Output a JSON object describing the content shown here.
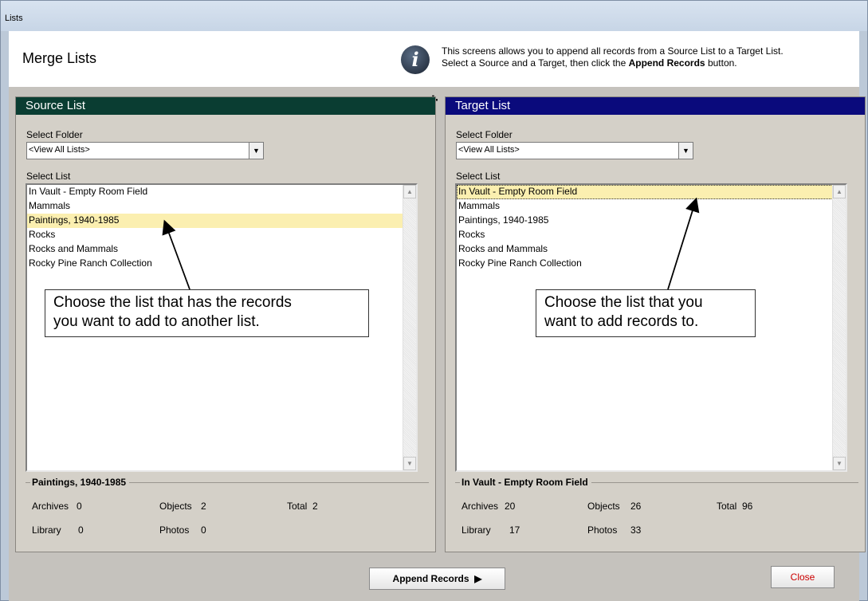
{
  "window": {
    "title": "Lists"
  },
  "header": {
    "title": "Merge Lists",
    "info_icon": "info-icon",
    "desc_line1": "This screens allows you to append all records from a Source List to a Target List.",
    "desc_line2_prefix": "Select a Source and a Target, then click the ",
    "desc_line2_bold": "Append Records",
    "desc_line2_suffix": " button."
  },
  "plus_symbol": "+",
  "source": {
    "header": "Source List",
    "folder_label": "Select Folder",
    "folder_value": "<View All Lists>",
    "list_label": "Select List",
    "items": [
      "In Vault - Empty Room Field",
      "Mammals",
      "Paintings, 1940-1985",
      "Rocks",
      "Rocks and Mammals",
      "Rocky Pine Ranch Collection"
    ],
    "selected_item": "Paintings, 1940-1985",
    "callout_line1": "Choose the list that has the records",
    "callout_line2": "you want to add to another list.",
    "summary_title": "Paintings, 1940-1985",
    "stats": {
      "archives_label": "Archives",
      "archives": "0",
      "objects_label": "Objects",
      "objects": "2",
      "total_label": "Total",
      "total": "2",
      "library_label": "Library",
      "library": "0",
      "photos_label": "Photos",
      "photos": "0"
    }
  },
  "target": {
    "header": "Target List",
    "folder_label": "Select Folder",
    "folder_value": "<View All Lists>",
    "list_label": "Select List",
    "items": [
      "In Vault - Empty Room Field",
      "Mammals",
      "Paintings, 1940-1985",
      "Rocks",
      "Rocks and Mammals",
      "Rocky Pine Ranch Collection"
    ],
    "selected_item": "In Vault - Empty Room Field",
    "callout_line1": "Choose the list that you",
    "callout_line2": "want to add records to.",
    "summary_title": "In Vault - Empty Room Field",
    "stats": {
      "archives_label": "Archives",
      "archives": "20",
      "objects_label": "Objects",
      "objects": "26",
      "total_label": "Total",
      "total": "96",
      "library_label": "Library",
      "library": "17",
      "photos_label": "Photos",
      "photos": "33"
    }
  },
  "buttons": {
    "append_label": "Append Records",
    "append_icon": "play-right-icon",
    "close_label": "Close"
  },
  "colors": {
    "source_header": "#0a3d32",
    "target_header": "#0a0a7c",
    "selected_row": "#fbefb0",
    "close_text": "#cc0000"
  }
}
